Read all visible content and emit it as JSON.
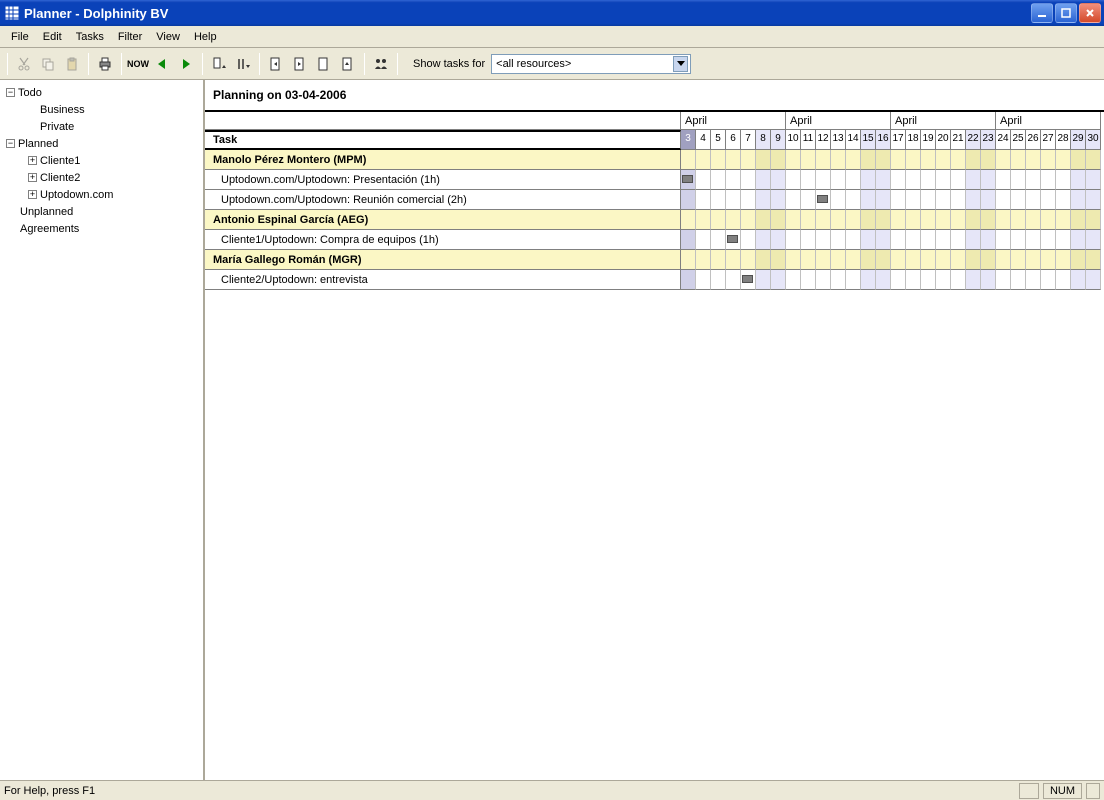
{
  "title": "Planner  - Dolphinity BV",
  "menu": [
    "File",
    "Edit",
    "Tasks",
    "Filter",
    "View",
    "Help"
  ],
  "toolbar": {
    "now_label": "NOW",
    "show_tasks_label": "Show tasks for",
    "resource_selected": "<all resources>"
  },
  "tree": {
    "todo": {
      "label": "Todo",
      "children": [
        "Business",
        "Private"
      ]
    },
    "planned": {
      "label": "Planned",
      "children": [
        "Cliente1",
        "Cliente2",
        "Uptodown.com"
      ]
    },
    "unplanned": {
      "label": "Unplanned"
    },
    "agreements": {
      "label": "Agreements"
    }
  },
  "planning": {
    "title": "Planning on 03-04-2006",
    "task_header": "Task",
    "month_label": "April",
    "days": [
      3,
      4,
      5,
      6,
      7,
      8,
      9,
      10,
      11,
      12,
      13,
      14,
      15,
      16,
      17,
      18,
      19,
      20,
      21,
      22,
      23,
      24,
      25,
      26,
      27,
      28,
      29,
      30
    ],
    "weekend_days": [
      8,
      9,
      15,
      16,
      22,
      23,
      29,
      30
    ],
    "selected_day": 3,
    "rows": [
      {
        "type": "resource",
        "label": "Manolo Pérez Montero (MPM)"
      },
      {
        "type": "task",
        "label": "Uptodown.com/Uptodown: Presentación (1h)",
        "bar_day": 3
      },
      {
        "type": "task",
        "label": "Uptodown.com/Uptodown: Reunión comercial (2h)",
        "bar_day": 12
      },
      {
        "type": "resource",
        "label": "Antonio Espinal García (AEG)"
      },
      {
        "type": "task",
        "label": "Cliente1/Uptodown: Compra de equipos (1h)",
        "bar_day": 6
      },
      {
        "type": "resource",
        "label": "María Gallego Román (MGR)"
      },
      {
        "type": "task",
        "label": "Cliente2/Uptodown: entrevista",
        "bar_day": 7
      }
    ]
  },
  "statusbar": {
    "help": "For Help, press F1",
    "num": "NUM"
  }
}
